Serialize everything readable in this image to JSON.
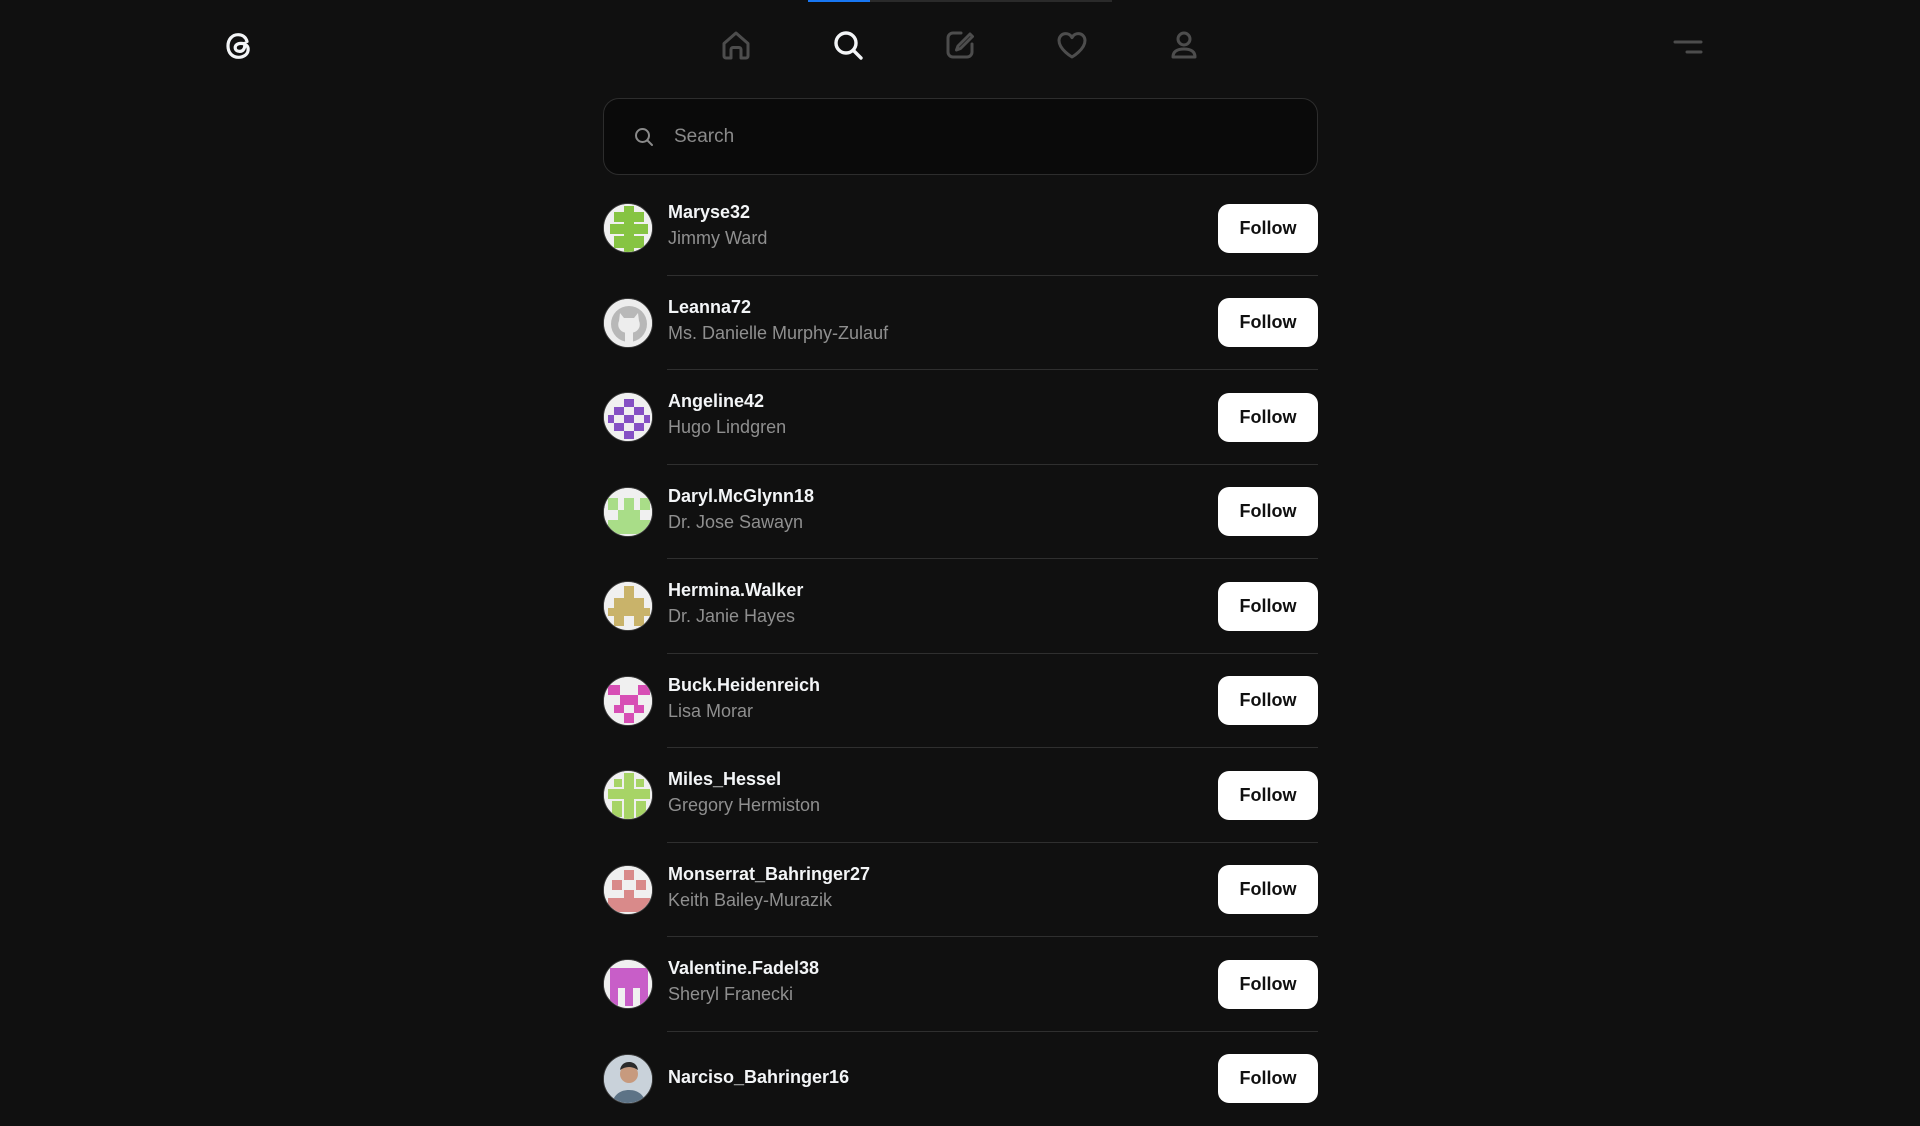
{
  "nav": {
    "items": [
      {
        "name": "home",
        "active": false
      },
      {
        "name": "search",
        "active": true
      },
      {
        "name": "create",
        "active": false
      },
      {
        "name": "activity",
        "active": false
      },
      {
        "name": "profile",
        "active": false
      }
    ]
  },
  "search": {
    "placeholder": "Search",
    "value": ""
  },
  "colors": {
    "background": "#101010",
    "primary_text": "#f3f5f7",
    "secondary_text": "#8f8f8f",
    "follow_button_bg": "#ffffff",
    "progress_accent": "#1877f2"
  },
  "users": [
    {
      "username": "Maryse32",
      "fullname": "Jimmy Ward",
      "follow_label": "Follow",
      "avatar_color": "#86c443",
      "avatar_icon": "identicon"
    },
    {
      "username": "Leanna72",
      "fullname": "Ms. Danielle Murphy-Zulauf",
      "follow_label": "Follow",
      "avatar_color": "#b8b8b8",
      "avatar_icon": "github-octocat"
    },
    {
      "username": "Angeline42",
      "fullname": "Hugo Lindgren",
      "follow_label": "Follow",
      "avatar_color": "#8551c4",
      "avatar_icon": "identicon"
    },
    {
      "username": "Daryl.McGlynn18",
      "fullname": "Dr. Jose Sawayn",
      "follow_label": "Follow",
      "avatar_color": "#a9dd88",
      "avatar_icon": "identicon"
    },
    {
      "username": "Hermina.Walker",
      "fullname": "Dr. Janie Hayes",
      "follow_label": "Follow",
      "avatar_color": "#c9b36a",
      "avatar_icon": "identicon"
    },
    {
      "username": "Buck.Heidenreich",
      "fullname": "Lisa Morar",
      "follow_label": "Follow",
      "avatar_color": "#d74fb5",
      "avatar_icon": "identicon"
    },
    {
      "username": "Miles_Hessel",
      "fullname": "Gregory Hermiston",
      "follow_label": "Follow",
      "avatar_color": "#a7d466",
      "avatar_icon": "identicon"
    },
    {
      "username": "Monserrat_Bahringer27",
      "fullname": "Keith Bailey-Murazik",
      "follow_label": "Follow",
      "avatar_color": "#d98a8a",
      "avatar_icon": "identicon"
    },
    {
      "username": "Valentine.Fadel38",
      "fullname": "Sheryl Franecki",
      "follow_label": "Follow",
      "avatar_color": "#c85ec8",
      "avatar_icon": "identicon"
    },
    {
      "username": "Narciso_Bahringer16",
      "fullname": "",
      "follow_label": "Follow",
      "avatar_color": "#7a8896",
      "avatar_icon": "photo"
    }
  ]
}
